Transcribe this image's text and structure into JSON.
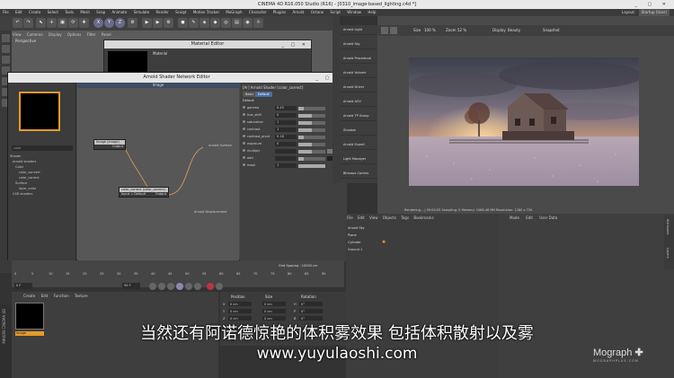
{
  "window": {
    "title": "CINEMA 4D R16.050 Studio (R16) - [0310_image-based_lighting.c4d *]",
    "layout_label": "Layout:",
    "layout_value": "Startup (User)"
  },
  "menubar": [
    "File",
    "Edit",
    "Create",
    "Select",
    "Tools",
    "Mesh",
    "Snap",
    "Animate",
    "Simulate",
    "Render",
    "Sculpt",
    "Motion Tracker",
    "MoGraph",
    "Character",
    "Plugins",
    "Arnold",
    "Octane",
    "Script",
    "Window",
    "Help"
  ],
  "toolbar": {
    "xyz": [
      "X",
      "Y",
      "Z"
    ]
  },
  "viewport": {
    "menu": [
      "View",
      "Cameras",
      "Display",
      "Options",
      "Filter",
      "Panel"
    ],
    "label": "Perspective"
  },
  "material_editor": {
    "title": "Material Editor",
    "label": "Material"
  },
  "arnold_editor": {
    "title": "Arnold Shader Network Editor",
    "canvas_title": "Image",
    "search": "color",
    "tree": [
      "Shader",
      "Arnold shaders",
      "Color",
      "color_convert",
      "color_correct",
      "Surface",
      "layer_color",
      "C4D shaders"
    ],
    "nodes": {
      "image": {
        "title": "Image (image)",
        "port": "Output"
      },
      "cc": {
        "title": "color_correct (color_correct)",
        "in": "Input",
        "in_default": "Default",
        "out": "Output"
      },
      "surface_label": "Arnold Surface",
      "displacement_label": "Arnold Displacement"
    },
    "params_title": "[Ar] Arnold Shader [color_correct]",
    "tabs": [
      "Basic",
      "Default"
    ],
    "section": "Default",
    "params": [
      {
        "label": "gamma",
        "value": "0.45",
        "fill": 0.2
      },
      {
        "label": "hue_shift",
        "value": "0",
        "fill": 0.5
      },
      {
        "label": "saturation",
        "value": "1",
        "fill": 0.5
      },
      {
        "label": "contrast",
        "value": "1",
        "fill": 0.5
      },
      {
        "label": "contrast_pivot",
        "value": "0.18",
        "fill": 0.2
      },
      {
        "label": "exposure",
        "value": "0",
        "fill": 0.5
      },
      {
        "label": "multiply",
        "value": "",
        "fill": 0.5
      },
      {
        "label": "add",
        "value": "",
        "fill": 0.2
      },
      {
        "label": "mask",
        "value": "1",
        "fill": 1
      }
    ]
  },
  "arnold_panel": [
    "Arnold Light",
    "Arnold Sky",
    "Arnold Procedural",
    "Arnold Volume",
    "Arnold Driver",
    "Arnold AOV",
    "Arnold TP Group",
    "Shadow",
    "Arnold Export",
    "Light Manager",
    "Bitmaps Caches"
  ],
  "render_view": {
    "size_label": "Size",
    "size_value": "100 %",
    "zoom_label": "Zoom",
    "zoom_value": "52 %",
    "display_label": "Display",
    "display_value": "Beauty",
    "snapshot": "Snapshot",
    "status": "Rendering... | 00:00:05   Sampling: 5   Memory: 1066.46 MB   Resolution: 1280 x 720"
  },
  "timeline": {
    "grid_spacing": "Grid Spacing : 10000 cm",
    "frame_left": "0 F",
    "frame_right": "90 F",
    "ticks": [
      "0",
      "5",
      "10",
      "15",
      "20",
      "25",
      "30",
      "35",
      "40",
      "45",
      "50",
      "55",
      "60",
      "65",
      "70",
      "75",
      "80",
      "85",
      "90"
    ]
  },
  "material_manager": {
    "menu": [
      "Create",
      "Edit",
      "Function",
      "Texture"
    ],
    "material_label": "Image"
  },
  "coords": {
    "headers": [
      "Position",
      "Size",
      "Rotation"
    ],
    "rows": [
      [
        "X",
        "0 cm",
        "0 cm",
        "H",
        "0°"
      ],
      [
        "Y",
        "0 cm",
        "0 cm",
        "P",
        "0°"
      ],
      [
        "Z",
        "0 cm",
        "0 cm",
        "B",
        "0°"
      ]
    ]
  },
  "object_manager": {
    "menu": [
      "File",
      "Edit",
      "View",
      "Objects",
      "Tags",
      "Bookmarks"
    ],
    "rows": [
      "Arnold Sky",
      "Plane",
      "Cylinder",
      "Ground 1"
    ]
  },
  "attribute_manager": {
    "menu": [
      "Mode",
      "Edit",
      "User Data"
    ]
  },
  "side_tabs": [
    "Attributes",
    "Layers"
  ],
  "left_vertical": "MAXON CINEMA 4D",
  "subtitles": {
    "zh": "当然还有阿诺德惊艳的体积雾效果 包括体积散射以及雾",
    "url": "www.yuyulaoshi.com"
  },
  "watermark": {
    "brand": "Mograph",
    "sub": "MOGRAPHPLUS.COM"
  }
}
